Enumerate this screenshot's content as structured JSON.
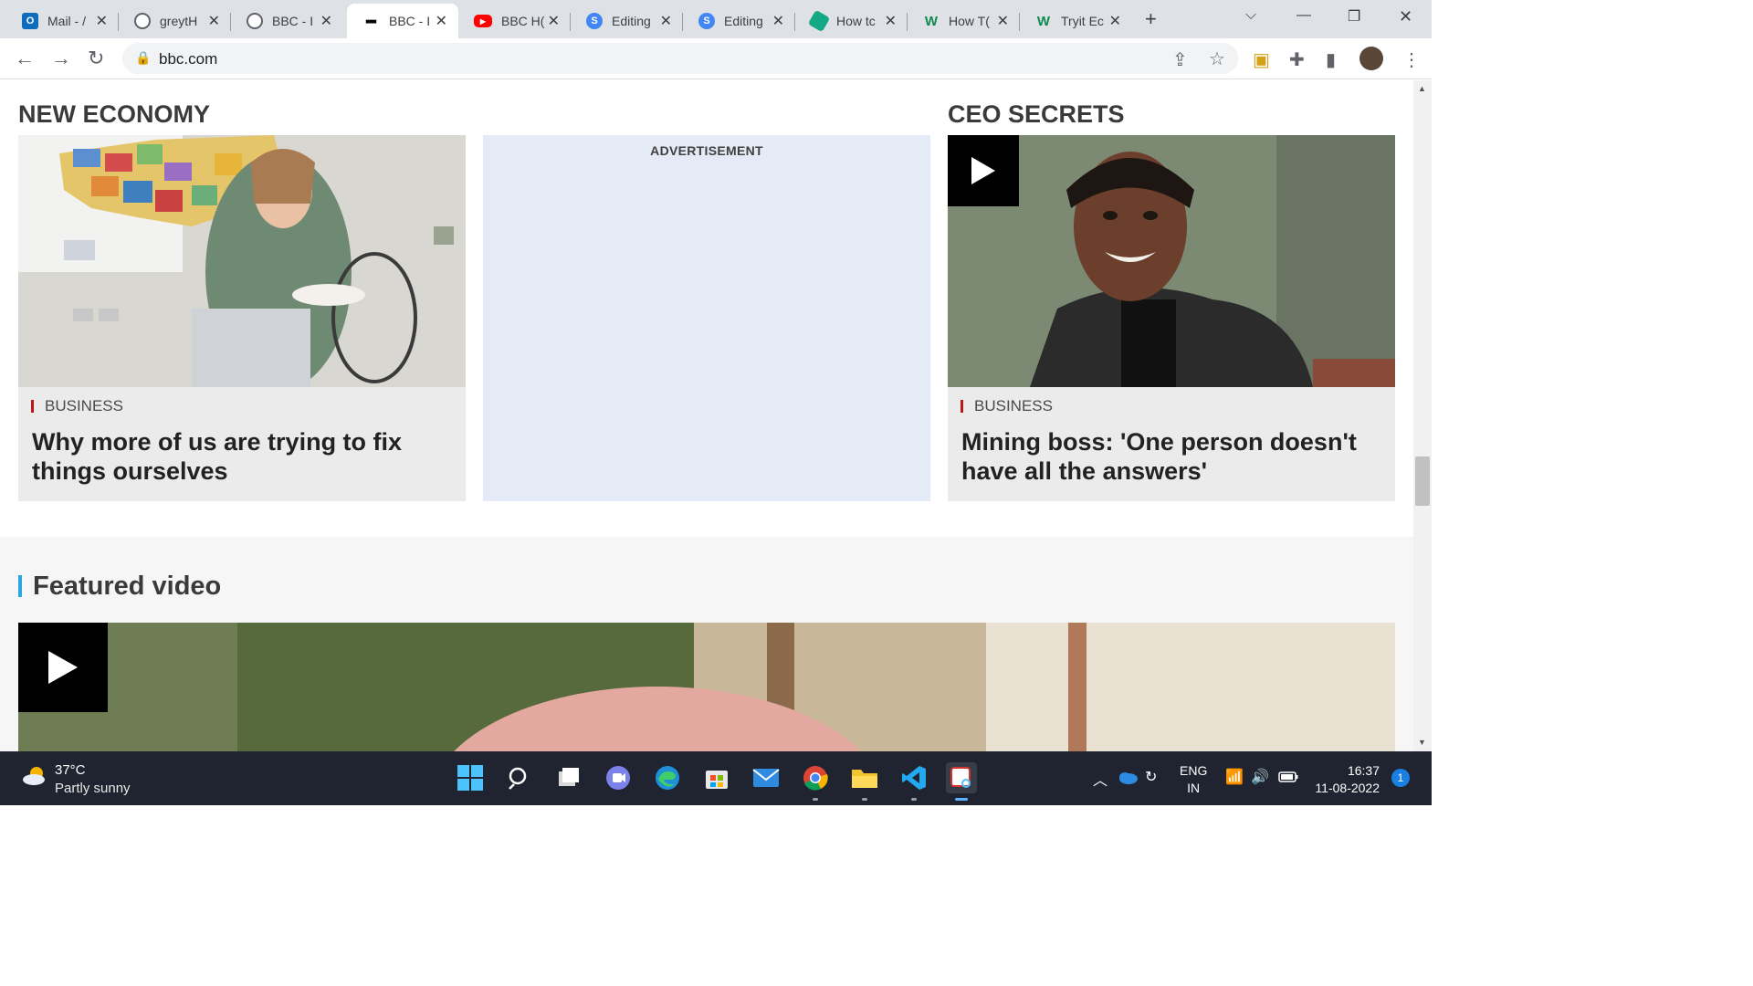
{
  "browser": {
    "tabs": [
      {
        "label": "Mail - /",
        "icon": "outlook-icon",
        "color": "#0f6cbd",
        "glyph": "O"
      },
      {
        "label": "greytH",
        "icon": "globe-icon",
        "color": "#5f6368",
        "glyph": ""
      },
      {
        "label": "BBC - I",
        "icon": "globe-icon",
        "color": "#5f6368",
        "glyph": ""
      },
      {
        "label": "BBC - I",
        "icon": "bbc-icon",
        "color": "#000000",
        "glyph": "■■■",
        "active": true
      },
      {
        "label": "BBC H(",
        "icon": "youtube-icon",
        "color": "#ff0000",
        "glyph": "▶"
      },
      {
        "label": "Editing",
        "icon": "editor-icon",
        "color": "#4285f4",
        "glyph": "S"
      },
      {
        "label": "Editing",
        "icon": "editor-icon",
        "color": "#4285f4",
        "glyph": "S"
      },
      {
        "label": "How tc",
        "icon": "hexagon-icon",
        "color": "#14a887",
        "glyph": ""
      },
      {
        "label": "How T(",
        "icon": "w-icon",
        "color": "#0e8a4f",
        "glyph": "W"
      },
      {
        "label": "Tryit Ec",
        "icon": "w-icon",
        "color": "#0e8a4f",
        "glyph": "W"
      }
    ],
    "url": "bbc.com"
  },
  "page": {
    "new_economy": {
      "section_title": "NEW ECONOMY",
      "category": "BUSINESS",
      "headline": "Why more of us are trying to fix things ourselves"
    },
    "advertisement_label": "ADVERTISEMENT",
    "ceo_secrets": {
      "section_title": "CEO SECRETS",
      "category": "BUSINESS",
      "headline": "Mining boss: 'One person doesn't have all the answers'"
    },
    "featured": {
      "title": "Featured video"
    }
  },
  "taskbar": {
    "temperature": "37°C",
    "weather": "Partly sunny",
    "lang_top": "ENG",
    "lang_bottom": "IN",
    "time": "16:37",
    "date": "11-08-2022",
    "notification_count": "1"
  },
  "colors": {
    "accent_business": "#bb1919",
    "featured_bar": "#2ba6de",
    "ad_bg": "#e4eaf6"
  }
}
